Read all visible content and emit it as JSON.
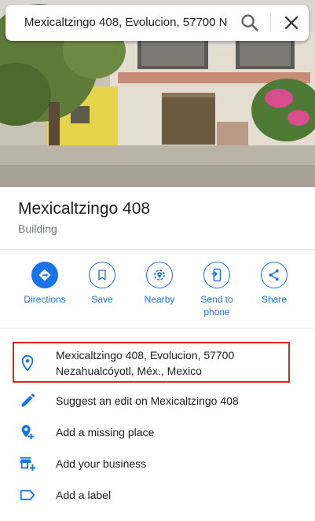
{
  "search": {
    "query": "Mexicaltzingo 408, Evolucion, 57700 N"
  },
  "place": {
    "name": "Mexicaltzingo 408",
    "category": "Building"
  },
  "actions": [
    {
      "label": "Directions"
    },
    {
      "label": "Save"
    },
    {
      "label": "Nearby"
    },
    {
      "label": "Send to\nphone"
    },
    {
      "label": "Share"
    }
  ],
  "details": {
    "address_line1": "Mexicaltzingo 408, Evolucion, 57700",
    "address_line2": "Nezahualcóyotl, Méx., Mexico",
    "suggest_edit": "Suggest an edit on Mexicaltzingo 408",
    "add_missing_place": "Add a missing place",
    "add_business": "Add your business",
    "add_label": "Add a label"
  },
  "colors": {
    "accent": "#1a73e8",
    "highlight_border": "#e0242e"
  }
}
